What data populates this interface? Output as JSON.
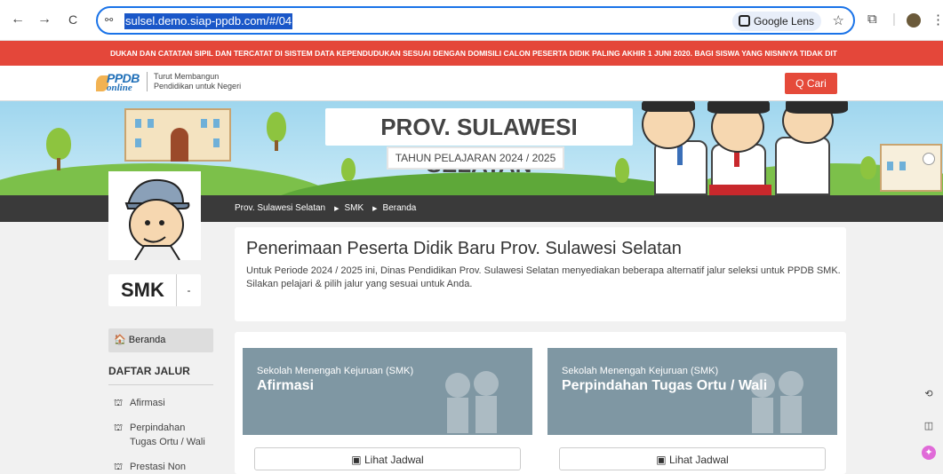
{
  "browser": {
    "url": "sulsel.demo.siap-ppdb.com/#/04",
    "lens_label": "Google Lens",
    "back_icon": "←",
    "forward_icon": "→",
    "reload_icon": "C"
  },
  "marquee": {
    "text": "DUKAN DAN CATATAN SIPIL DAN TERCATAT DI SISTEM DATA KEPENDUDUKAN SESUAI DENGAN DOMISILI CALON PESERTA DIDIK PALING AKHIR 1 JUNI 2020. BAGI SISWA YANG NISNNYA TIDAK DIT"
  },
  "site": {
    "logo_text": "PPDB",
    "logo_sub": "online",
    "tagline_1": "Turut Membangun",
    "tagline_2": "Pendidikan untuk Negeri",
    "search_label": "Q Cari"
  },
  "banner": {
    "title": "PROV. SULAWESI SELATAN",
    "year": "TAHUN PELAJARAN 2024 / 2025"
  },
  "breadcrumb": [
    "Prov. Sulawesi Selatan",
    "SMK",
    "Beranda"
  ],
  "level": {
    "label": "SMK",
    "toggle": "-"
  },
  "menu": {
    "home": "Beranda",
    "heading": "DAFTAR JALUR",
    "items": [
      "Afirmasi",
      "Perpindahan Tugas Ortu / Wali",
      "Prestasi Non"
    ]
  },
  "intro": {
    "title": "Penerimaan Peserta Didik Baru Prov. Sulawesi Selatan",
    "line1": "Untuk Periode 2024 / 2025 ini, Dinas Pendidikan Prov. Sulawesi Selatan menyediakan beberapa alternatif jalur seleksi untuk PPDB SMK.",
    "line2": "Silakan pelajari & pilih jalur yang sesuai untuk Anda."
  },
  "jalur_cards": [
    {
      "sub": "Sekolah Menengah Kejuruan (SMK)",
      "name": "Afirmasi",
      "button": "Lihat Jadwal"
    },
    {
      "sub": "Sekolah Menengah Kejuruan (SMK)",
      "name": "Perpindahan Tugas Ortu / Wali",
      "button": "Lihat Jadwal"
    }
  ],
  "colors": {
    "accent_red": "#e4473a",
    "card_header": "#7f97a3",
    "dark_bar": "#3a3a3a"
  }
}
